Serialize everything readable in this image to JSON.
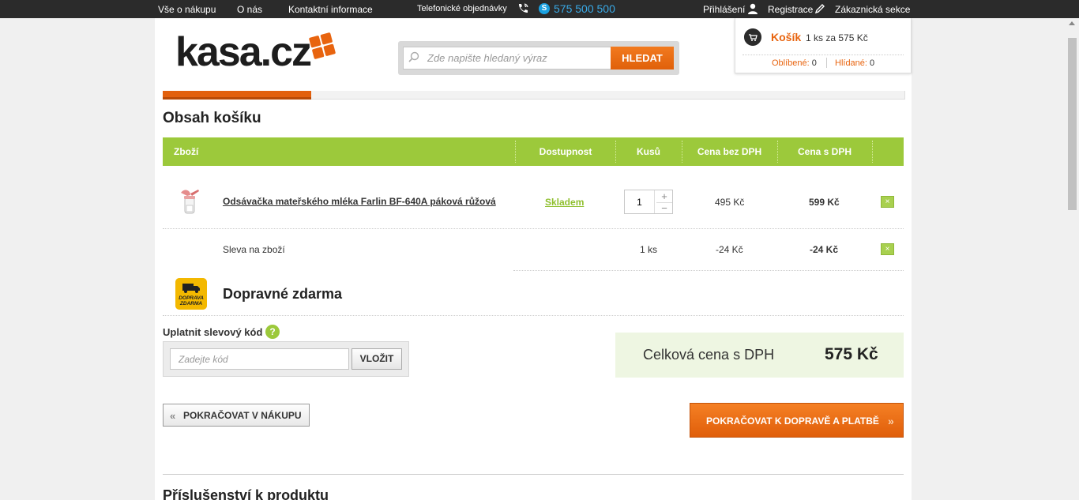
{
  "topbar": {
    "nav": [
      "Vše o nákupu",
      "O nás",
      "Kontaktní informace"
    ],
    "phone_label": "Telefonické objednávky",
    "phone_number": "575 500 500",
    "login": "Přihlášení",
    "register": "Registrace",
    "customer_section": "Zákaznická sekce"
  },
  "logo": {
    "text": "kasa.cz"
  },
  "search": {
    "placeholder": "Zde napište hledaný výraz",
    "button": "HLEDAT"
  },
  "cart_widget": {
    "title": "Košík",
    "summary": "1 ks za 575 Kč",
    "favorites_label": "Oblíbené:",
    "favorites_count": "0",
    "watched_label": "Hlídané:",
    "watched_count": "0"
  },
  "page": {
    "title": "Obsah košíku"
  },
  "table": {
    "headers": [
      "Zboží",
      "Dostupnost",
      "Kusů",
      "Cena bez DPH",
      "Cena s DPH"
    ],
    "rows": [
      {
        "product": "Odsávačka mateřského mléka Farlin BF-640A páková růžová",
        "availability": "Skladem",
        "quantity": "1",
        "price_without_vat": "495 Kč",
        "price_with_vat": "599 Kč",
        "delete": "×"
      },
      {
        "product": "Sleva na zboží",
        "quantity": "1 ks",
        "price_without_vat": "-24 Kč",
        "price_with_vat": "-24 Kč",
        "delete": "×"
      }
    ]
  },
  "shipping": {
    "text": "Dopravné zdarma",
    "badge": "DOPRAVA ZDARMA"
  },
  "coupon": {
    "label": "Uplatnit slevový kód",
    "help": "?",
    "placeholder": "Zadejte kód",
    "button": "VLOŽIT"
  },
  "total": {
    "label": "Celková cena s DPH",
    "value": "575 Kč"
  },
  "actions": {
    "back": "POKRAČOVAT V NÁKUPU",
    "back_chevron": "«",
    "next": "POKRAČOVAT K DOPRAVĚ A PLATBĚ",
    "next_chevron": "»"
  },
  "accessories": {
    "title": "Příslušenství k produktu"
  },
  "colors": {
    "accent_orange": "#e8640f",
    "table_header_green": "#9cc93b",
    "topbar": "#2b2b2b"
  }
}
